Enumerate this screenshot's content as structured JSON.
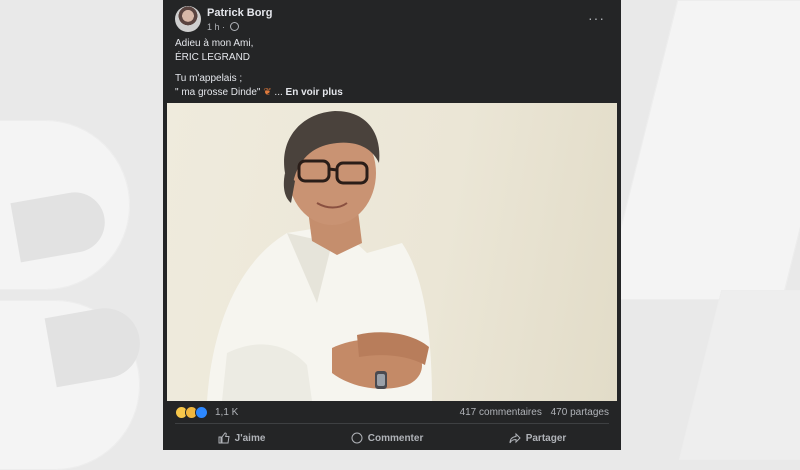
{
  "post": {
    "author": "Patrick Borg",
    "time": "1 h",
    "separator": "·",
    "more": "···",
    "lines": {
      "l1": "Adieu à mon Ami,",
      "l2": "ÉRIC LEGRAND",
      "l3": "Tu m'appelais ;",
      "l4": "\" ma grosse Dinde\"",
      "ellipsis": " ...",
      "see_more": "En voir plus"
    }
  },
  "reactions": {
    "icons": [
      "sad-icon",
      "care-icon",
      "like-icon"
    ],
    "count": "1,1 K",
    "comments": "417 commentaires",
    "shares": "470 partages"
  },
  "actions": {
    "like": "J'aime",
    "comment": "Commenter",
    "share": "Partager"
  },
  "colors": {
    "card": "#242526",
    "text": "#e4e6eb",
    "muted": "#b0b3b8",
    "like_blue": "#2d88ff"
  }
}
